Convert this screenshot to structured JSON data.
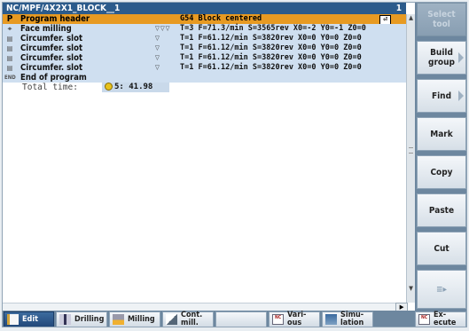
{
  "window": {
    "path": "NC/MPF/4X2X1_BLOCK__1",
    "channel": "1"
  },
  "program": {
    "rows": [
      {
        "icon": "P",
        "name": "Program header",
        "arrows": "",
        "params": "G54 Block centered"
      },
      {
        "icon": "⌖",
        "name": "Face milling",
        "arrows": "▽▽▽",
        "params": "T=3 F=71.3/min S=3565rev X0=-2 Y0=-1 Z0=0"
      },
      {
        "icon": "▤",
        "name": "Circumfer. slot",
        "arrows": "▽",
        "params": "T=1 F=61.12/min S=3820rev X0=0 Y0=0 Z0=0"
      },
      {
        "icon": "▤",
        "name": "Circumfer. slot",
        "arrows": "▽",
        "params": "T=1 F=61.12/min S=3820rev X0=0 Y0=0 Z0=0"
      },
      {
        "icon": "▤",
        "name": "Circumfer. slot",
        "arrows": "▽",
        "params": "T=1 F=61.12/min S=3820rev X0=0 Y0=0 Z0=0"
      },
      {
        "icon": "▤",
        "name": "Circumfer. slot",
        "arrows": "▽",
        "params": "T=1 F=61.12/min S=3820rev X0=0 Y0=0 Z0=0"
      },
      {
        "icon": "END",
        "name": "End of program",
        "arrows": "",
        "params": ""
      }
    ],
    "total_time_label": "Total time:",
    "total_time_value": "5: 41.98",
    "enter_symbol": "⏎"
  },
  "vertical_softkeys": [
    {
      "label": "Select tool",
      "enabled": false
    },
    {
      "label": "Build group",
      "enabled": true
    },
    {
      "label": "Find",
      "enabled": true
    },
    {
      "label": "Mark",
      "enabled": true
    },
    {
      "label": "Copy",
      "enabled": true
    },
    {
      "label": "Paste",
      "enabled": true
    },
    {
      "label": "Cut",
      "enabled": true
    },
    {
      "label": "",
      "enabled": true
    }
  ],
  "horizontal_softkeys": [
    {
      "label": "Edit",
      "icon": "edit-icon"
    },
    {
      "label": "Drilling",
      "icon": "drilling-icon"
    },
    {
      "label": "Milling",
      "icon": "milling-icon"
    },
    {
      "label": "Cont.\nmill.",
      "icon": "contour-mill-icon"
    },
    {
      "label": "Vari-\nous",
      "icon": "nc-icon"
    },
    {
      "label": "Simu-\nlation",
      "icon": "simulation-icon"
    },
    {
      "label": "Ex-\necute",
      "icon": "nc-execute-icon"
    }
  ],
  "nc_icon_text": "NC"
}
